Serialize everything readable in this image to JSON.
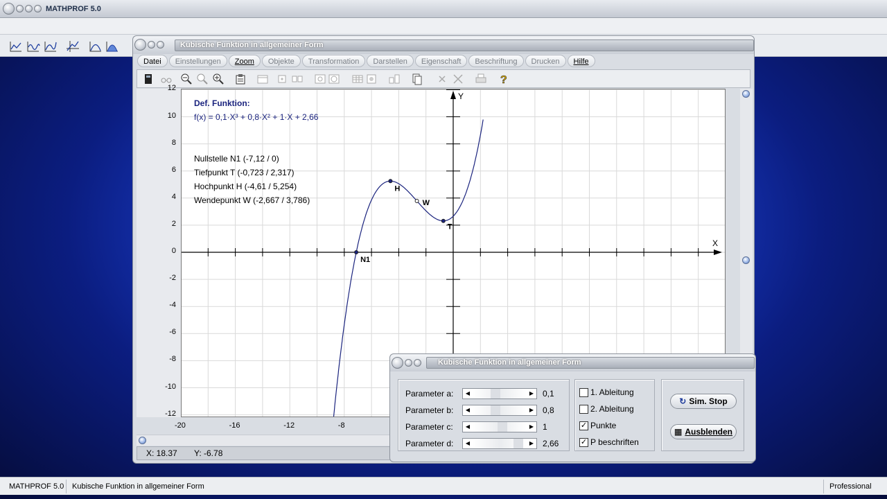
{
  "app": {
    "title": "MATHPROF 5.0"
  },
  "window": {
    "title": "Kubische Funktion in allgemeiner Form",
    "menu": [
      {
        "label": "Datei",
        "active": true
      },
      {
        "label": "Einstellungen",
        "active": false
      },
      {
        "label": "Zoom",
        "active": true
      },
      {
        "label": "Objekte",
        "active": false
      },
      {
        "label": "Transformation",
        "active": false
      },
      {
        "label": "Darstellen",
        "active": false
      },
      {
        "label": "Eigenschaft",
        "active": false
      },
      {
        "label": "Beschriftung",
        "active": false
      },
      {
        "label": "Drucken",
        "active": false
      },
      {
        "label": "Hilfe",
        "active": true
      }
    ],
    "coords": {
      "x": "X: 18.37",
      "y": "Y: -6.78"
    }
  },
  "graph": {
    "def_title": "Def. Funktion:",
    "formula": "f(x) = 0,1·X³ + 0,8·X² + 1·X + 2,66",
    "info": [
      "Nullstelle N1 (-7,12 / 0)",
      "Tiefpunkt T (-0,723 / 2,317)",
      "Hochpunkt H (-4,61 / 5,254)",
      "Wendepunkt W (-2,667 / 3,786)"
    ],
    "axis_x_label": "X",
    "axis_y_label": "Y",
    "x_ticks": [
      "-20",
      "-16",
      "-12",
      "-8"
    ],
    "y_ticks": [
      "12",
      "10",
      "8",
      "6",
      "4",
      "2",
      "0",
      "-2",
      "-4",
      "-6",
      "-8",
      "-10",
      "-12"
    ],
    "points": [
      {
        "name": "N1",
        "x": -7.12,
        "y": 0
      },
      {
        "name": "H",
        "x": -4.61,
        "y": 5.254
      },
      {
        "name": "W",
        "x": -2.667,
        "y": 3.786
      },
      {
        "name": "T",
        "x": -0.723,
        "y": 2.317
      }
    ],
    "coefficients": {
      "a": 0.1,
      "b": 0.8,
      "c": 1,
      "d": 2.66
    },
    "curve_color": "#1a237e",
    "text_color": "#1a237e"
  },
  "panel": {
    "title": "Kubische Funktion in allgemeiner Form",
    "params": [
      {
        "label": "Parameter a:",
        "value": "0,1"
      },
      {
        "label": "Parameter b:",
        "value": "0,8"
      },
      {
        "label": "Parameter c:",
        "value": "1"
      },
      {
        "label": "Parameter d:",
        "value": "2,66"
      }
    ],
    "checks": [
      {
        "label": "1. Ableitung",
        "checked": false
      },
      {
        "label": "2. Ableitung",
        "checked": false
      },
      {
        "label": "Punkte",
        "checked": true
      },
      {
        "label": "P beschriften",
        "checked": true
      }
    ],
    "sim_button": "Sim. Stop",
    "hide_button": "Ausblenden"
  },
  "status": {
    "app": "MATHPROF 5.0",
    "doc": "Kubische Funktion in allgemeiner Form",
    "edition": "Professional"
  }
}
